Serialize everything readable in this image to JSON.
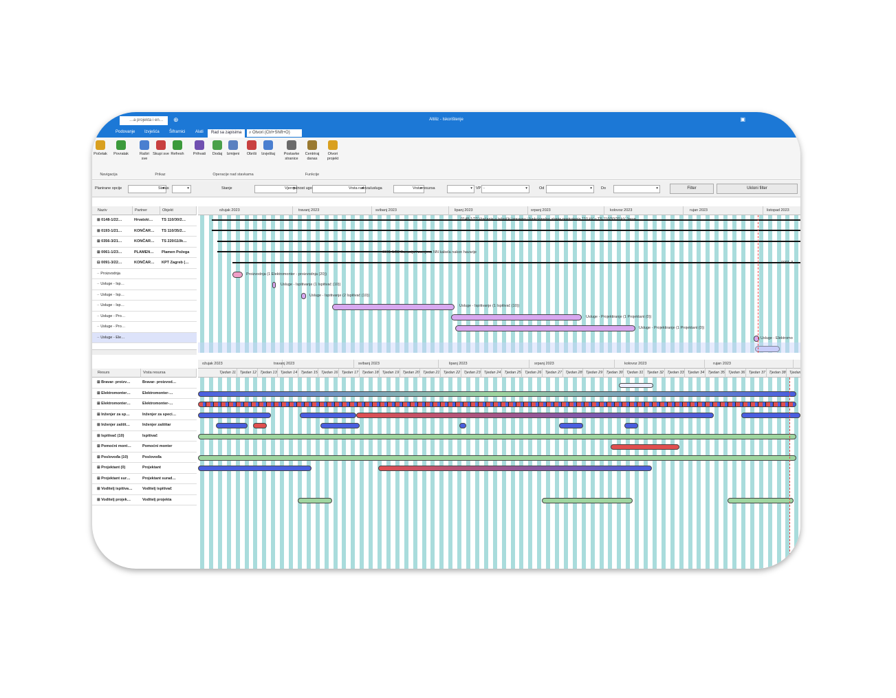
{
  "window": {
    "doc_tab": "…a projekta i en…",
    "title": "Altiliz - Iskorištenje"
  },
  "menu": {
    "items": [
      "Podovanje",
      "Izvješća",
      "Šifrarnici",
      "Alati",
      "Rad sa zapisima"
    ],
    "search_placeholder": "Otvori (Ctrl+Shift+O)"
  },
  "ribbon": {
    "buttons": [
      "Početak",
      "Povratak",
      "Raširi sve",
      "Skupi sve",
      "Refresh",
      "Prihvati",
      "Dodaj",
      "Izmijeni",
      "Obriši",
      "Izvještaj",
      "Postavke stranice",
      "Centriraj danas",
      "Otvori projekt"
    ],
    "groups": [
      "Navigacija",
      "Prikaz",
      "Operacije nad stavkama",
      "Funkcije"
    ]
  },
  "filters": {
    "labels": [
      "Planirane opcije",
      "Status",
      "Stanje",
      "Vjerojatnost ugovaranja",
      "Vrsta radova/usluga",
      "Vrsta resursa",
      "VP",
      "Od",
      "Do"
    ],
    "vp_value": "-",
    "filter_button": "Filter",
    "clear_button": "Ukloni filter"
  },
  "projects": {
    "columns": [
      "Naziv",
      "Partner",
      "Objekt"
    ],
    "rows": [
      {
        "naziv": "⊞ 0148-1/22…",
        "partner": "Hrvatski…",
        "objekt": "TS 110/30/2…"
      },
      {
        "naziv": "⊞ 0193-1/21…",
        "partner": "KONČAR…",
        "objekt": "TS 110/35/2…"
      },
      {
        "naziv": "⊞ 0356-3/21…",
        "partner": "KONČAR…",
        "objekt": "TS 220/110k…"
      },
      {
        "naziv": "⊞ 0061-1/23…",
        "partner": "PLAMEN…",
        "objekt": "Plamen Požega"
      },
      {
        "naziv": "⊟ 0091-3/22…",
        "partner": "KONČAR…",
        "objekt": "KPT Zagreb (…"
      },
      {
        "naziv": "·· Proizvodnja",
        "partner": "",
        "objekt": ""
      },
      {
        "naziv": "·· Usluge - Isp…",
        "partner": "",
        "objekt": ""
      },
      {
        "naziv": "·· Usluge - Isp…",
        "partner": "",
        "objekt": ""
      },
      {
        "naziv": "·· Usluge - Isp…",
        "partner": "",
        "objekt": ""
      },
      {
        "naziv": "·· Usluge - Pro…",
        "partner": "",
        "objekt": ""
      },
      {
        "naziv": "·· Usluge - Pro…",
        "partner": "",
        "objekt": ""
      },
      {
        "naziv": "·· Usluge - Ele…",
        "partner": "",
        "objekt": ""
      }
    ],
    "months": [
      "ožujak 2023",
      "travanj 2023",
      "svibanj 2023",
      "lipanj 2023",
      "srpanj 2023",
      "kolovoz 2023",
      "rujan 2023",
      "listopad 2023"
    ],
    "bar_labels": [
      "0148-1/22 Vraćanje u tehnički ispravno i funkcionalno stanje postrojenja 110 kV u TS 110/30/20 kV Jarun",
      "0061-1/23 Sanacija i zamjena NN kabela nakon havarije",
      "0091-3,",
      "Proizvodnja (1 Elektromonter - proizvodnja (20))",
      "Usluge - Ispitivanje (1 Ispitivač (10))",
      "Usluge - Ispitivanje (2 Ispitivač (10))",
      "Usluge - Ispitivanje (1 Ispitivač (10))",
      "Usluge - Projektiranje (1 Projektant (0))",
      "Usluge - Projektiranje (1 Projektant (0))",
      "Usluge - Elektromo",
      "Usluge"
    ]
  },
  "resources": {
    "columns": [
      "Resurs",
      "Vrsta resursa"
    ],
    "rows": [
      {
        "resurs": "⊞ Bravar- proizv…",
        "vrsta": "Bravar- proizvod…"
      },
      {
        "resurs": "⊞ Elektromonter…",
        "vrsta": "Elektromonter-…"
      },
      {
        "resurs": "⊞ Elektromonter…",
        "vrsta": "Elektromonter-…"
      },
      {
        "resurs": "⊞ Inženjer za sp…",
        "vrsta": "Inženjer za speci…"
      },
      {
        "resurs": "⊞ Inženjer zaštit…",
        "vrsta": "Inženjer zaštitar"
      },
      {
        "resurs": "⊞ Ispitivač (10)",
        "vrsta": "Ispitivač"
      },
      {
        "resurs": "⊞ Pomoćni mont…",
        "vrsta": "Pomoćni monter"
      },
      {
        "resurs": "⊞ Poslovođa (10)",
        "vrsta": "Poslovođa"
      },
      {
        "resurs": "⊞ Projektant (0)",
        "vrsta": "Projektant"
      },
      {
        "resurs": "⊞ Projektant sur…",
        "vrsta": "Projektant surad…"
      },
      {
        "resurs": "⊞ Voditelj ispitiva…",
        "vrsta": "Voditelj ispitivač"
      },
      {
        "resurs": "⊞ Voditelj projek…",
        "vrsta": "Voditelj projekta"
      }
    ],
    "weeks": [
      "Tjedan 11",
      "Tjedan 12",
      "Tjedan 13",
      "Tjedan 14",
      "Tjedan 15",
      "Tjedan 16",
      "Tjedan 17",
      "Tjedan 18",
      "Tjedan 19",
      "Tjedan 20",
      "Tjedan 21",
      "Tjedan 22",
      "Tjedan 23",
      "Tjedan 24",
      "Tjedan 25",
      "Tjedan 26",
      "Tjedan 27",
      "Tjedan 28",
      "Tjedan 29",
      "Tjedan 30",
      "Tjedan 31",
      "Tjedan 32",
      "Tjedan 33",
      "Tjedan 34",
      "Tjedan 35",
      "Tjedan 36",
      "Tjedan 37",
      "Tjedan 38",
      "Tjedan 39"
    ]
  },
  "colors": {
    "accent": "#1c78d6",
    "stripe": "#a9dcdc",
    "bar_blue": "#4a5fe0",
    "bar_red": "#e05050",
    "bar_green": "#9fd6a0",
    "bar_purple": "#d8a8f0"
  }
}
